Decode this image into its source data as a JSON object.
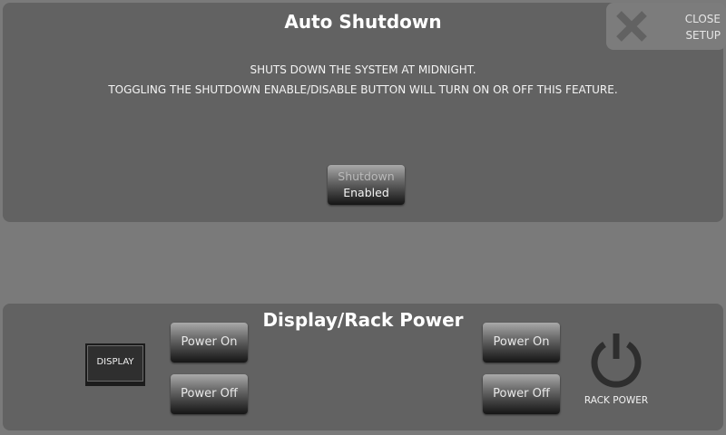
{
  "auto_shutdown": {
    "title": "Auto Shutdown",
    "description_line1": "SHUTS DOWN THE SYSTEM AT MIDNIGHT.",
    "description_line2": "TOGGLING THE SHUTDOWN ENABLE/DISABLE BUTTON WILL TURN ON OR OFF THIS FEATURE.",
    "toggle_button": {
      "line1": "Shutdown",
      "line2": "Enabled"
    }
  },
  "close_setup": {
    "icon": "close-icon",
    "line1": "CLOSE",
    "line2": "SETUP"
  },
  "display_rack_power": {
    "title": "Display/Rack Power",
    "display": {
      "icon": "display-icon",
      "label": "DISPLAY",
      "power_on_label": "Power On",
      "power_off_label": "Power Off"
    },
    "rack": {
      "icon": "power-icon",
      "label": "RACK POWER",
      "power_on_label": "Power On",
      "power_off_label": "Power Off"
    }
  },
  "colors": {
    "background": "#7a7a7a",
    "panel": "#626262",
    "close_button": "#7c7c7c",
    "text": "#ffffff",
    "icon_dark": "#2e2e2e"
  }
}
